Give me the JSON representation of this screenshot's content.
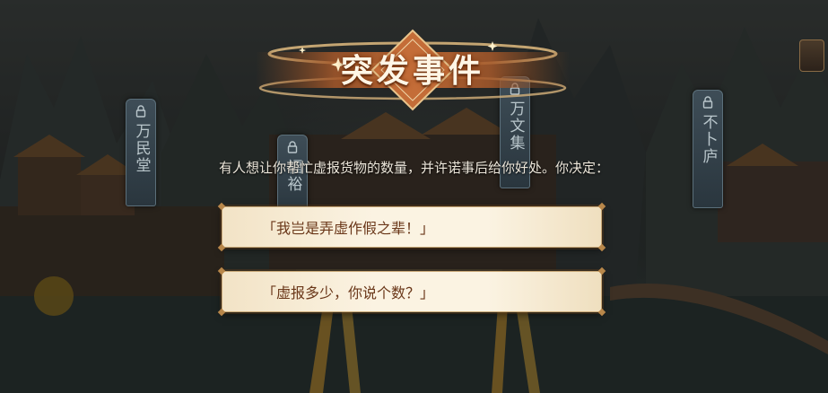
{
  "event": {
    "title": "突发事件",
    "prompt": "有人想让你帮忙虚报货物的数量，并许诺事后给你好处。你决定："
  },
  "choices": [
    {
      "label": "「我岂是弄虚作假之辈！」"
    },
    {
      "label": "「虚报多少，你说个数？」"
    }
  ],
  "signs": [
    {
      "label": "万民堂"
    },
    {
      "label": "福裕"
    },
    {
      "label": "万文集"
    },
    {
      "label": "不卜庐"
    }
  ],
  "icons": [
    "lock-icon",
    "menu-icon"
  ]
}
